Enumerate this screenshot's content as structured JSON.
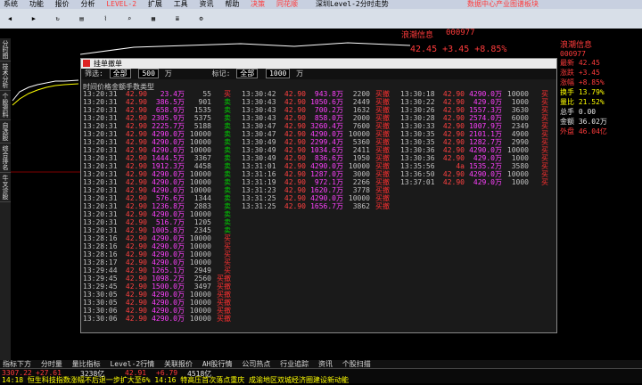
{
  "menu": [
    "系统",
    "功能",
    "报价",
    "分析",
    "LEVEL-2",
    "扩展",
    "工具",
    "资讯",
    "帮助",
    "决策"
  ],
  "toolbar_brand": "同花顺",
  "window_title": "深圳Level-2分时走势",
  "top_right": "数据中心产业图谱板块",
  "stock": {
    "name": "浪潮信息",
    "code": "000977",
    "price": "42.45",
    "change": "+3.45",
    "pct": "+8.85%"
  },
  "left_tabs": [
    "分时图",
    "技术分析",
    "个股资料",
    "自选股",
    "综合排名",
    "牛叉诊股"
  ],
  "dialog": {
    "title": "挂单撤单",
    "filter_label": "筛选:",
    "filter_value": "全部",
    "vol": "500",
    "unit": "万",
    "mark_label": "标记:",
    "mark_value": "全部",
    "vol2": "1000",
    "unit2": "万",
    "headers": [
      "时间",
      "价格",
      "金额",
      "手数",
      "类型"
    ]
  },
  "col1": [
    [
      "13:20:31",
      "42.90",
      "23.4万",
      "55",
      "买"
    ],
    [
      "13:20:31",
      "42.90",
      "386.5万",
      "901",
      "卖"
    ],
    [
      "13:20:31",
      "42.90",
      "658.9万",
      "1535",
      "卖"
    ],
    [
      "13:20:31",
      "42.90",
      "2305.9万",
      "5375",
      "卖"
    ],
    [
      "13:20:31",
      "42.90",
      "2225.7万",
      "5188",
      "卖"
    ],
    [
      "13:20:31",
      "42.90",
      "4290.0万",
      "10000",
      "卖"
    ],
    [
      "13:20:31",
      "42.90",
      "4290.0万",
      "10000",
      "卖"
    ],
    [
      "13:20:31",
      "42.90",
      "4290.0万",
      "10000",
      "卖"
    ],
    [
      "13:20:31",
      "42.90",
      "1444.5万",
      "3367",
      "卖"
    ],
    [
      "13:20:31",
      "42.90",
      "1912.3万",
      "4458",
      "卖"
    ],
    [
      "13:20:31",
      "42.90",
      "4290.0万",
      "10000",
      "卖"
    ],
    [
      "13:20:31",
      "42.90",
      "4290.0万",
      "10000",
      "卖"
    ],
    [
      "13:20:31",
      "42.90",
      "4290.0万",
      "10000",
      "卖"
    ],
    [
      "13:20:31",
      "42.90",
      "576.6万",
      "1344",
      "卖"
    ],
    [
      "13:20:31",
      "42.90",
      "1236.8万",
      "2883",
      "卖"
    ],
    [
      "13:20:31",
      "42.90",
      "4290.0万",
      "10000",
      "卖"
    ],
    [
      "13:20:31",
      "42.90",
      "516.7万",
      "1205",
      "卖"
    ],
    [
      "13:20:31",
      "42.90",
      "1005.8万",
      "2345",
      "卖"
    ],
    [
      "13:28:16",
      "42.90",
      "4290.0万",
      "10000",
      "买"
    ],
    [
      "13:28:16",
      "42.90",
      "4290.0万",
      "10000",
      "买"
    ],
    [
      "13:28:16",
      "42.90",
      "4290.0万",
      "10000",
      "买"
    ],
    [
      "13:28:17",
      "42.90",
      "4290.0万",
      "10000",
      "买"
    ],
    [
      "13:29:44",
      "42.90",
      "1265.1万",
      "2949",
      "买"
    ],
    [
      "13:29:45",
      "42.90",
      "1098.2万",
      "2560",
      "买撤"
    ],
    [
      "13:29:45",
      "42.90",
      "1500.0万",
      "3497",
      "买撤"
    ],
    [
      "13:30:05",
      "42.90",
      "4290.0万",
      "10000",
      "买撤"
    ],
    [
      "13:30:05",
      "42.90",
      "4290.0万",
      "10000",
      "买撤"
    ],
    [
      "13:30:06",
      "42.90",
      "4290.0万",
      "10000",
      "买撤"
    ],
    [
      "13:30:06",
      "42.90",
      "4290.0万",
      "10000",
      "买撤"
    ]
  ],
  "col2": [
    [
      "13:30:42",
      "42.90",
      "943.8万",
      "2200",
      "买撤"
    ],
    [
      "13:30:43",
      "42.90",
      "1050.6万",
      "2449",
      "买撤"
    ],
    [
      "13:30:43",
      "42.90",
      "700.2万",
      "1632",
      "买撤"
    ],
    [
      "13:30:43",
      "42.90",
      "858.0万",
      "2000",
      "买撤"
    ],
    [
      "13:30:47",
      "42.90",
      "3260.4万",
      "7600",
      "买撤"
    ],
    [
      "13:30:47",
      "42.90",
      "4290.0万",
      "10000",
      "买撤"
    ],
    [
      "13:30:49",
      "42.90",
      "2299.4万",
      "5360",
      "买撤"
    ],
    [
      "13:30:49",
      "42.90",
      "1034.6万",
      "2411",
      "买撤"
    ],
    [
      "13:30:49",
      "42.90",
      "836.6万",
      "1950",
      "买撤"
    ],
    [
      "13:31:01",
      "42.90",
      "4290.0万",
      "10000",
      "买撤"
    ],
    [
      "13:31:16",
      "42.90",
      "1287.0万",
      "3000",
      "买撤"
    ],
    [
      "13:31:19",
      "42.90",
      "972.1万",
      "2266",
      "买撤"
    ],
    [
      "13:31:23",
      "42.90",
      "1620.7万",
      "3778",
      "买撤"
    ],
    [
      "13:31:25",
      "42.90",
      "4290.0万",
      "10000",
      "买撤"
    ],
    [
      "13:31:25",
      "42.90",
      "1656.7万",
      "3862",
      "买撤"
    ]
  ],
  "col3": [
    [
      "13:30:18",
      "42.90",
      "4290.0万",
      "10000",
      "买"
    ],
    [
      "13:30:22",
      "42.90",
      "429.0万",
      "1000",
      "买"
    ],
    [
      "13:30:26",
      "42.90",
      "1557.3万",
      "3630",
      "买"
    ],
    [
      "13:30:28",
      "42.90",
      "2574.0万",
      "6000",
      "买"
    ],
    [
      "13:30:33",
      "42.90",
      "1007.9万",
      "2349",
      "买"
    ],
    [
      "13:30:35",
      "42.90",
      "2101.1万",
      "4900",
      "买"
    ],
    [
      "13:30:35",
      "42.90",
      "1282.7万",
      "2990",
      "买"
    ],
    [
      "13:30:36",
      "42.90",
      "4290.0万",
      "10000",
      "买"
    ],
    [
      "13:30:36",
      "42.90",
      "429.0万",
      "1000",
      "买"
    ],
    [
      "13:35:56",
      "4a",
      "1535.2万",
      "3580",
      "买"
    ],
    [
      "13:36:50",
      "42.90",
      "4290.0万",
      "10000",
      "买"
    ],
    [
      "13:37:01",
      "42.90",
      "429.0万",
      "1000",
      "买"
    ]
  ],
  "right_panel": {
    "name": "浪潮信息",
    "code": "000977",
    "rows": [
      "最新 42.45",
      "涨跌 +3.45",
      "涨幅 +8.85%",
      "换手 13.79%",
      "量比 21.52%",
      "总手 0.00",
      "金额 36.02万",
      "外盘 46.04亿"
    ]
  },
  "bottom_ticker": "14:18 恒生科技指数涨幅不后退一步扩大至6%  14:16 特高压首次落点重庆 成渝地区双城经济圈建设新动能",
  "index": {
    "sh": "3307.22",
    "sh_chg": "+27.61",
    "sz": "3238亿",
    "cyb": "42.91",
    "cyb_chg": "+6.79",
    "amt": "4518亿"
  },
  "tabs": [
    "指标下方",
    "分时量",
    "量比指标",
    "Level-2行情",
    "关联报价",
    "AH股行情",
    "公司热点",
    "行业追踪",
    "资讯",
    "个股扫描"
  ]
}
